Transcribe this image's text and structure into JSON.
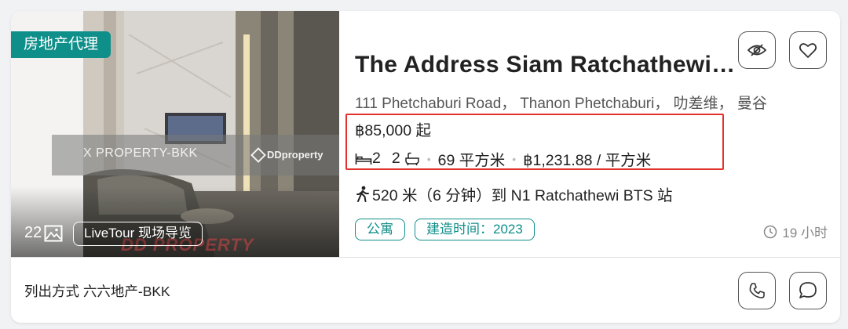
{
  "listing": {
    "agent_badge": "房地产代理",
    "photo_count": "22",
    "livetour_label": "LiveTour 现场导览",
    "watermark_text": "X    PROPERTY-BKK",
    "watermark_logo": "DDproperty",
    "watermark_bottom": "DD PROPERTY",
    "title": "The Address Siam Ratchathewi Condominium",
    "address": "111 Phetchaburi Road， Thanon Phetchaburi， 叻差维， 曼谷",
    "price": "฿85,000 起",
    "bedrooms": "2",
    "bathrooms": "2",
    "area": "69 平方米",
    "price_per_sqm": "฿1,231.88 / 平方米",
    "transit": "520 米（6 分钟）到 N1 Ratchathewi BTS 站",
    "tags": [
      "公寓",
      "建造时间：2023"
    ],
    "posted": "19 小时",
    "listed_by_prefix": "列出方式",
    "listed_by_agency": "六六地产-BKK"
  },
  "icons": {
    "hide": "eye-slash-icon",
    "favorite": "heart-icon",
    "phone": "phone-icon",
    "chat": "chat-bubble-icon",
    "bed": "bed-icon",
    "bath": "bathtub-icon",
    "walk": "walking-person-icon",
    "clock": "clock-icon",
    "photos": "image-icon"
  },
  "colors": {
    "accent": "#0f8f8a",
    "highlight_border": "#e0322b"
  }
}
